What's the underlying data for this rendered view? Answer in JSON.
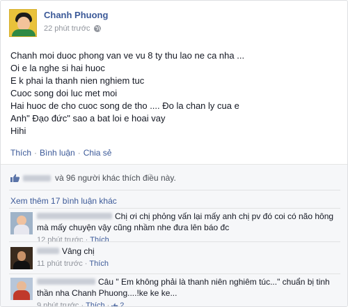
{
  "post": {
    "author": "Chanh Phuong",
    "time": "22 phút trước",
    "privacy_icon": "globe-icon",
    "lines": [
      "Chanh moi duoc phong van ve vu 8 ty thu lao ne ca nha ...",
      "Oi e la nghe si hai huoc",
      "E k phai la thanh nien nghiem tuc",
      "Cuoc song doi luc met moi",
      "Hai huoc de cho cuoc song de tho .... Đo la chan ly cua e",
      "Anh\" Đạo đức\" sao a bat loi e hoai vay",
      "Hihi"
    ]
  },
  "actions": {
    "like": "Thích",
    "comment": "Bình luận",
    "share": "Chia sẻ"
  },
  "likes": {
    "text": "và 96 người khác thích điều này."
  },
  "comments_section": {
    "more_label": "Xem thêm 17 bình luận khác",
    "comments": [
      {
        "text": "Chị ơi chị phỏng vấn lại mấy anh chị pv đó coi có não hông mà mấy chuyện vậy cũng nhầm nhe đưa lên báo đc",
        "time": "12 phút trước",
        "like_label": "Thích"
      },
      {
        "text": "Vâng chị",
        "time": "11 phút trước",
        "like_label": "Thích"
      },
      {
        "text": "Câu \" Em không phải là thanh niên nghiêm túc...\" chuẩn bị tinh thần nha Chanh Phuong....!ke ke ke...",
        "time": "9 phút trước",
        "like_label": "Thích",
        "like_count": "2"
      }
    ]
  },
  "colors": {
    "link": "#3b5998",
    "meta": "#90949c",
    "feedback_bg": "#f6f7f9"
  }
}
